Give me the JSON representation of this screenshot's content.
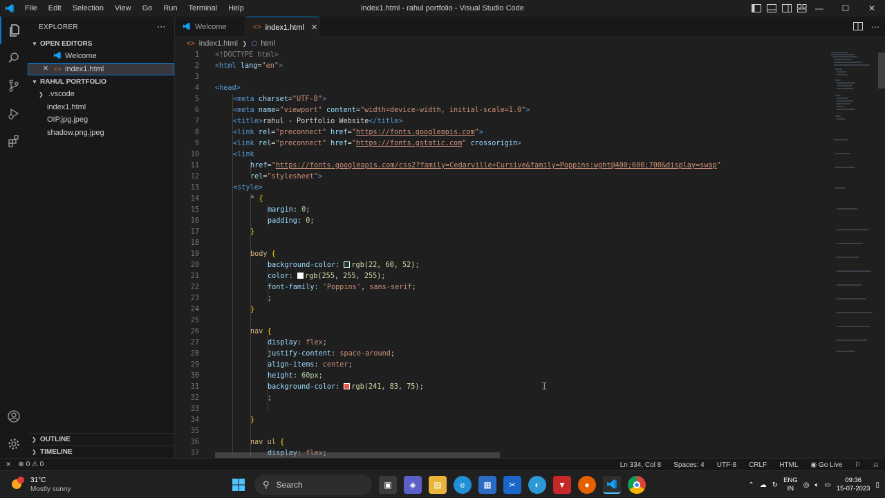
{
  "window": {
    "title": "index1.html - rahul portfolio - Visual Studio Code",
    "menu": [
      "File",
      "Edit",
      "Selection",
      "View",
      "Go",
      "Run",
      "Terminal",
      "Help"
    ]
  },
  "sidebar": {
    "header": "EXPLORER",
    "open_editors_title": "OPEN EDITORS",
    "open_editors": [
      {
        "label": "Welcome",
        "icon": "vscode-icon"
      },
      {
        "label": "index1.html",
        "icon": "html-icon"
      }
    ],
    "folder_title": "RAHUL PORTFOLIO",
    "files": [
      {
        "label": ".vscode",
        "type": "folder"
      },
      {
        "label": "index1.html",
        "type": "html"
      },
      {
        "label": "OIP.jpg.jpeg",
        "type": "image"
      },
      {
        "label": "shadow.png.jpeg",
        "type": "image"
      }
    ],
    "outline_title": "OUTLINE",
    "timeline_title": "TIMELINE"
  },
  "tabs": [
    {
      "label": "Welcome",
      "active": false
    },
    {
      "label": "index1.html",
      "active": true
    }
  ],
  "breadcrumb": {
    "file": "index1.html",
    "node": "html"
  },
  "editor": {
    "lines": [
      {
        "n": "1"
      },
      {
        "n": "2"
      },
      {
        "n": "3"
      },
      {
        "n": "4"
      },
      {
        "n": "5"
      },
      {
        "n": "6"
      },
      {
        "n": "7"
      },
      {
        "n": "8"
      },
      {
        "n": "9"
      },
      {
        "n": "10"
      },
      {
        "n": "11"
      },
      {
        "n": "12"
      },
      {
        "n": "13"
      },
      {
        "n": "14"
      },
      {
        "n": "15"
      },
      {
        "n": "16"
      },
      {
        "n": "17"
      },
      {
        "n": "18"
      },
      {
        "n": "19"
      },
      {
        "n": "20"
      },
      {
        "n": "21"
      },
      {
        "n": "22"
      },
      {
        "n": "23"
      },
      {
        "n": "24"
      },
      {
        "n": "25"
      },
      {
        "n": "26"
      },
      {
        "n": "27"
      },
      {
        "n": "28"
      },
      {
        "n": "29"
      },
      {
        "n": "30"
      },
      {
        "n": "31"
      },
      {
        "n": "32"
      },
      {
        "n": "33"
      },
      {
        "n": "34"
      },
      {
        "n": "35"
      },
      {
        "n": "36"
      },
      {
        "n": "37"
      }
    ],
    "code": {
      "l1_doctype": "<!DOCTYPE html>",
      "l2_html_open": "<html",
      "l2_lang_attr": " lang",
      "l2_lang_val": "\"en\"",
      "l2_close": ">",
      "l4_head": "<head>",
      "l5_meta": "<meta",
      "l5_charset": " charset",
      "l5_charset_val": "\"UTF-8\"",
      "l5_close": ">",
      "l6_meta": "<meta",
      "l6_name": " name",
      "l6_name_val": "\"viewport\"",
      "l6_content": " content",
      "l6_content_val": "\"width=device-width, initial-scale=1.0\"",
      "l6_close": ">",
      "l7_title_open": "<title>",
      "l7_title_text": "rahul - Portfolio Website",
      "l7_title_close": "</title>",
      "l8_link": "<link",
      "l8_rel": " rel",
      "l8_rel_val": "\"preconnect\"",
      "l8_href": " href",
      "l8_href_url": "https://fonts.googleapis.com",
      "l9_link": "<link",
      "l9_rel": " rel",
      "l9_rel_val": "\"preconnect\"",
      "l9_href": " href",
      "l9_href_url": "https://fonts.gstatic.com",
      "l9_crossorigin": " crossorigin",
      "l10_link": "<link",
      "l11_href": "href",
      "l11_url": "https://fonts.googleapis.com/css2?family=Cedarville+Cursive&family=Poppins:wght@400;600;700&display=swap",
      "l12_rel": "rel",
      "l12_rel_val": "\"stylesheet\"",
      "l12_close": ">",
      "l13_style": "<style>",
      "l14_sel": "*",
      "l15_prop": "margin",
      "l15_val": "0",
      "l16_prop": "padding",
      "l16_val": "0",
      "l19_sel": "body",
      "l20_prop": "background-color",
      "l20_val": "rgb(22, 60, 52)",
      "l20_swatch": "#163c34",
      "l21_prop": "color",
      "l21_val": "rgb(255, 255, 255)",
      "l21_swatch": "#ffffff",
      "l22_prop": "font-family",
      "l22_val1": "'Poppins'",
      "l22_val2": "sans-serif",
      "l26_sel": "nav",
      "l27_prop": "display",
      "l27_val": "flex",
      "l28_prop": "justify-content",
      "l28_val": "space-around",
      "l29_prop": "align-items",
      "l29_val": "center",
      "l30_prop": "height",
      "l30_val": "60px",
      "l31_prop": "background-color",
      "l31_val": "rgb(241, 83, 75)",
      "l31_swatch": "#f1534b",
      "l36_sel": "nav ul",
      "l37_prop": "display",
      "l37_val": "flex"
    }
  },
  "statusbar": {
    "errors": "0",
    "warnings": "0",
    "position": "Ln 334, Col 8",
    "spaces": "Spaces: 4",
    "encoding": "UTF-8",
    "eol": "CRLF",
    "language": "HTML",
    "go_live": "Go Live"
  },
  "taskbar": {
    "temperature": "31°C",
    "condition": "Mostly sunny",
    "search_placeholder": "Search",
    "lang_line1": "ENG",
    "lang_line2": "IN",
    "time": "09:36",
    "date": "15-07-2023"
  },
  "colors": {
    "accent": "#0078d4",
    "tag": "#569cd6",
    "attribute": "#9cdcfe",
    "string": "#ce9178",
    "selector": "#d7ba7d"
  }
}
